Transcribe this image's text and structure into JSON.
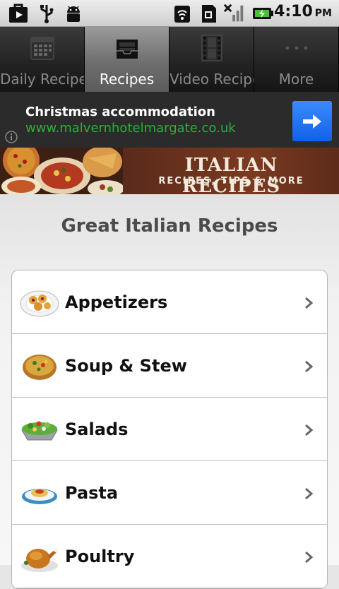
{
  "status_bar": {
    "time": "4:10",
    "ampm": "PM",
    "icons": [
      "bag-icon",
      "usb-icon",
      "android-debug-icon",
      "wifi-icon",
      "sim-icon",
      "no-signal-icon",
      "battery-charging-icon"
    ]
  },
  "tabs": [
    {
      "label": "Daily Recipes",
      "icon": "calendar-icon",
      "active": false
    },
    {
      "label": "Recipes",
      "icon": "inbox-icon",
      "active": true
    },
    {
      "label": "Video Recipe",
      "icon": "film-icon",
      "active": false
    },
    {
      "label": "More",
      "icon": "more-icon",
      "active": false
    }
  ],
  "ad": {
    "title": "Christmas accommodation",
    "url": "www.malvernhotelmargate.co.uk",
    "colors": {
      "url": "#2fae3c",
      "button": "#1a6cff"
    }
  },
  "header": {
    "title": "ITALIAN RECIPES",
    "subtitle": "RECIPES, TIPS & MORE"
  },
  "page_title": "Great Italian Recipes",
  "categories": [
    {
      "label": "Appetizers",
      "icon": "appetizer-plate-icon"
    },
    {
      "label": "Soup & Stew",
      "icon": "soup-bowl-icon"
    },
    {
      "label": "Salads",
      "icon": "salad-bowl-icon"
    },
    {
      "label": "Pasta",
      "icon": "pasta-plate-icon"
    },
    {
      "label": "Poultry",
      "icon": "roast-chicken-icon"
    }
  ]
}
